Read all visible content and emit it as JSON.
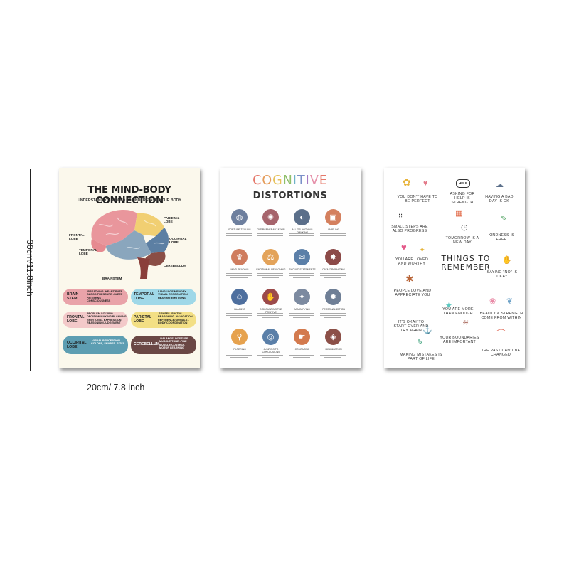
{
  "dimensions": {
    "height_label": "30cm/11.8inch",
    "width_label": "20cm/ 7.8 inch"
  },
  "poster1": {
    "title": "THE MIND-BODY CONNECTION",
    "subtitle": "UNDERSTAND YOUR MIND TO UNDERSTAND YOUR BODY",
    "brain_labels": {
      "parietal": "PARIETAL LOBE",
      "frontal": "FRONTAL LOBE",
      "occipital": "OCCIPITAL LOBE",
      "temporal": "TEMPORAL LOBE",
      "cerebellum": "CEREBELLUM",
      "brainstem": "BRAINSTEM"
    },
    "regions": [
      {
        "tag": "BRAIN STEM",
        "text": "-BREATHING -HEART RATE -BLOOD PRESSURE -SLEEP PATTERNS -CONSCIOUSNESS",
        "color": "#e9a3a9"
      },
      {
        "tag": "TEMPORAL LOBE",
        "text": "LANGUAGE MEMORY VISUAL RECOGNITION HEARING EMOTIONS",
        "color": "#9fd8e8"
      },
      {
        "tag": "FRONTAL LOBE",
        "text": "PROBLEM SOLVING DECISION MAKING PLANNING EMOTIONAL EXPRESSION REASONING/JUDGEMENT",
        "color": "#f3c9c9"
      },
      {
        "tag": "PARIETAL LOBE",
        "text": "-SENSES -SPATIAL REASONING -NAVIGATION -REFERENCE/SIGNALS -BODY COORDINATION",
        "color": "#f3df84"
      },
      {
        "tag": "OCCIPITAL LOBE",
        "text": "-VISUAL PERCEPTION -COLORS, SHAPES -SIZES",
        "color": "#5d9eb2"
      },
      {
        "tag": "CEREBELLUM",
        "text": "-BALANCE -POSTURE -MUSCLE TONE -FINE MUSCLE CONTROL -MOTOR LEARNING",
        "color": "#6a4744"
      }
    ]
  },
  "poster2": {
    "title_letters": [
      "C",
      "O",
      "G",
      "N",
      "I",
      "T",
      "I",
      "V",
      "E"
    ],
    "title_colors": [
      "#e5786a",
      "#e59c5a",
      "#e6c15a",
      "#8fbf6a",
      "#6fb3c7",
      "#7a8fc8",
      "#a57bc3",
      "#e58ea8",
      "#e5786a"
    ],
    "subtitle": "DISTORTIONS",
    "items": [
      {
        "label": "FORTUNE TELLING",
        "color": "#6d7f9e",
        "icon": "crystal-ball-icon",
        "glyph": "◍"
      },
      {
        "label": "OVERGENERALIZATION",
        "color": "#a6646c",
        "icon": "brain-icon",
        "glyph": "✺"
      },
      {
        "label": "ALL-OR-NOTHING THINKING",
        "color": "#5b6f8a",
        "icon": "half-circle-icon",
        "glyph": "◐"
      },
      {
        "label": "LABELING",
        "color": "#d4805e",
        "icon": "jar-icon",
        "glyph": "▣"
      },
      {
        "label": "MIND READING",
        "color": "#cf7c5e",
        "icon": "person-icon",
        "glyph": "♛"
      },
      {
        "label": "EMOTIONAL REASONING",
        "color": "#e3a35a",
        "icon": "scale-icon",
        "glyph": "⚖"
      },
      {
        "label": "SHOULD STATEMENTS",
        "color": "#5b7fa8",
        "icon": "speech-icon",
        "glyph": "✉"
      },
      {
        "label": "CATASTROPHIZING",
        "color": "#8c4a48",
        "icon": "fire-icon",
        "glyph": "✸"
      },
      {
        "label": "BLAMING",
        "color": "#4e6f9e",
        "icon": "people-icon",
        "glyph": "☺"
      },
      {
        "label": "DISCOUNTING THE POSITIVE",
        "color": "#9c4a4a",
        "icon": "thumbs-down-icon",
        "glyph": "✋"
      },
      {
        "label": "MAGNIFYING",
        "color": "#7c8aa0",
        "icon": "wand-icon",
        "glyph": "✦"
      },
      {
        "label": "PERSONALIZATION",
        "color": "#6f7f96",
        "icon": "spotlight-icon",
        "glyph": "✹"
      },
      {
        "label": "FILTERING",
        "color": "#e6a24e",
        "icon": "magnifier-icon",
        "glyph": "⚲"
      },
      {
        "label": "JUMPING TO CONCLUSIONS",
        "color": "#5a7fa8",
        "icon": "globe-icon",
        "glyph": "◎"
      },
      {
        "label": "COMPARING",
        "color": "#d37a4e",
        "icon": "pointing-icon",
        "glyph": "☛"
      },
      {
        "label": "MINIMIZATION",
        "color": "#8c5048",
        "icon": "tag-icon",
        "glyph": "◈"
      }
    ]
  },
  "poster3": {
    "title": "THINGS TO REMEMBER",
    "items": [
      "YOU DON'T HAVE TO BE PERFECT",
      "ASKING FOR HELP IS STRENGTH",
      "HAVING A BAD DAY IS OK",
      "SMALL STEPS ARE ALSO PROGRESS",
      "TOMORROW IS A NEW DAY",
      "KINDNESS IS FREE",
      "YOU ARE LOVED AND WORTHY",
      "SAYING \"NO\" IS OKAY",
      "PEOPLE LOVE AND APPRECIATE YOU",
      "YOU ARE MORE THAN ENOUGH",
      "BEAUTY & STRENGTH COME FROM WITHIN",
      "IT'S OKAY TO START OVER AND TRY AGAIN",
      "YOUR BOUNDARIES ARE IMPORTANT",
      "MAKING MISTAKES IS PART OF LIFE",
      "THE PAST CAN'T BE CHANGED"
    ],
    "help_bubble": "HELP"
  }
}
